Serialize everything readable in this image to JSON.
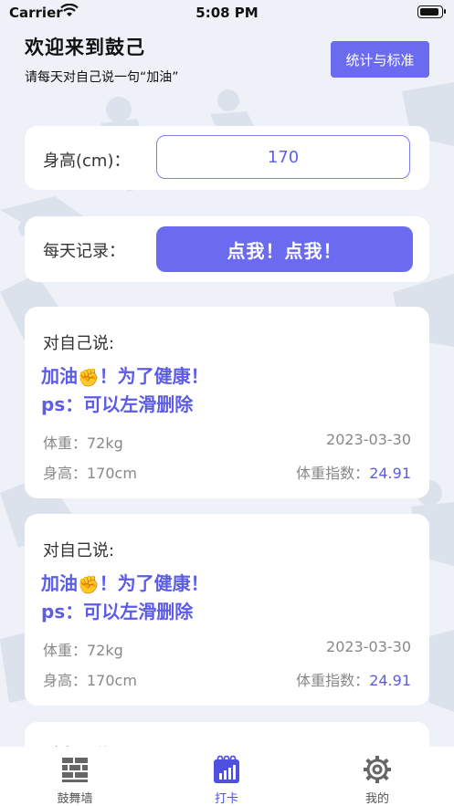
{
  "status_bar": {
    "carrier": "Carrier",
    "time": "5:08 PM"
  },
  "header": {
    "title": "欢迎来到鼓己",
    "subtitle": "请每天对自己说一句“加油”",
    "stats_button": "统计与标准"
  },
  "height_form": {
    "label": "身高(cm)：",
    "value": "170"
  },
  "record": {
    "label": "每天记录：",
    "button": "点我！点我！"
  },
  "entries": [
    {
      "say_label": "对自己说:",
      "message_line1": "加油",
      "message_emoji": "✊",
      "message_line1_rest": "！为了健康！",
      "message_line2": "ps：可以左滑删除",
      "weight": "体重：72kg",
      "date": "2023-03-30",
      "height": "身高：170cm",
      "bmi_label": "体重指数：",
      "bmi_value": "24.91"
    },
    {
      "say_label": "对自己说:",
      "message_line1": "加油",
      "message_emoji": "✊",
      "message_line1_rest": "！为了健康！",
      "message_line2": "ps：可以左滑删除",
      "weight": "体重：72kg",
      "date": "2023-03-30",
      "height": "身高：170cm",
      "bmi_label": "体重指数：",
      "bmi_value": "24.91"
    },
    {
      "say_label": "对自己说:"
    }
  ],
  "tabs": [
    {
      "label": "鼓舞墙",
      "icon": "brick-wall-icon",
      "active": false
    },
    {
      "label": "打卡",
      "icon": "calendar-chart-icon",
      "active": true
    },
    {
      "label": "我的",
      "icon": "gear-icon",
      "active": false
    }
  ],
  "colors": {
    "accent": "#6b6bf0",
    "accent_text": "#5c5ce6",
    "background": "#eef1f7",
    "card": "#ffffff"
  }
}
